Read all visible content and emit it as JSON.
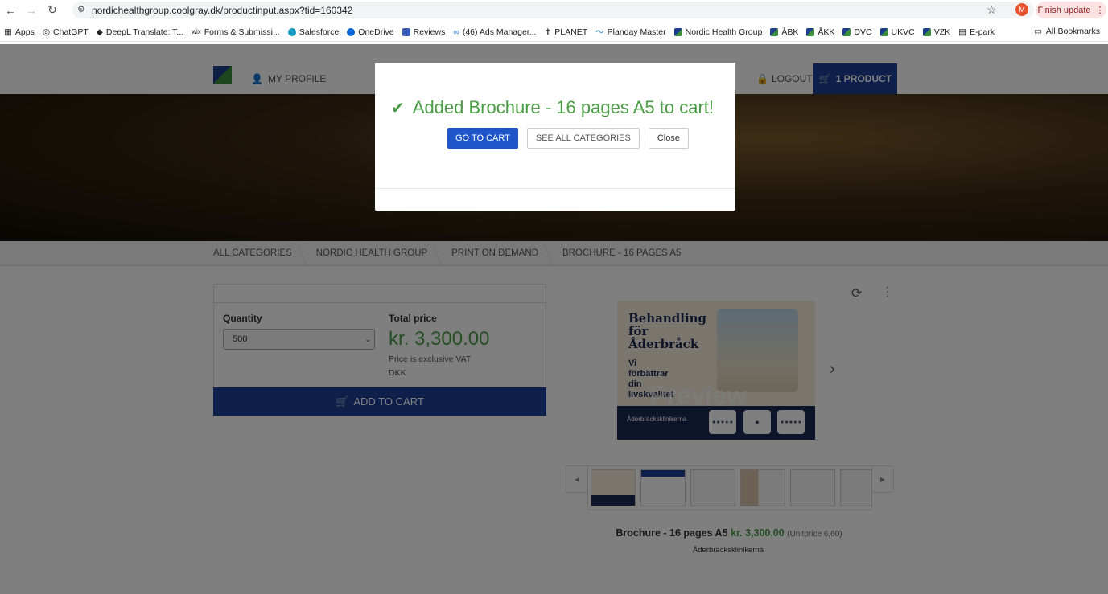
{
  "browser": {
    "url": "nordichealthgroup.coolgray.dk/productinput.aspx?tid=160342",
    "avatar_letter": "M",
    "finish_update": "Finish update",
    "bookmarks": [
      "Apps",
      "ChatGPT",
      "DeepL Translate: T...",
      "Forms & Submissi...",
      "Salesforce",
      "OneDrive",
      "Reviews",
      "(46) Ads Manager...",
      "PLANET",
      "Planday Master",
      "Nordic Health Group",
      "ÅBK",
      "ÅKK",
      "DVC",
      "UKVC",
      "VZK",
      "E-park"
    ],
    "all_bookmarks": "All Bookmarks"
  },
  "header": {
    "my_profile": "MY PROFILE",
    "logout": "LOGOUT",
    "cart": "1 PRODUCT"
  },
  "breadcrumb": [
    "ALL CATEGORIES",
    "NORDIC HEALTH GROUP",
    "PRINT ON DEMAND",
    "BROCHURE - 16 PAGES A5"
  ],
  "order": {
    "quantity_label": "Quantity",
    "quantity_value": "500",
    "total_label": "Total price",
    "total_price": "kr. 3,300.00",
    "vat_note": "Price is exclusive VAT",
    "currency": "DKK",
    "add_to_cart": "ADD TO CART"
  },
  "preview": {
    "title": "Behandling för Åderbråck",
    "subtitle": "Vi förbättrar din livskvalitet",
    "watermark": "Preview",
    "brand": "Åderbrácksklinikerna"
  },
  "caption": {
    "product": "Brochure - 16 pages A5",
    "price": "kr. 3,300.00",
    "unitprice": "(Unitprice 6,60)",
    "vendor": "Åderbräcksklinikerna"
  },
  "modal": {
    "message": "Added Brochure - 16 pages A5 to cart!",
    "go_to_cart": "GO TO CART",
    "see_all": "SEE ALL CATEGORIES",
    "close": "Close"
  }
}
